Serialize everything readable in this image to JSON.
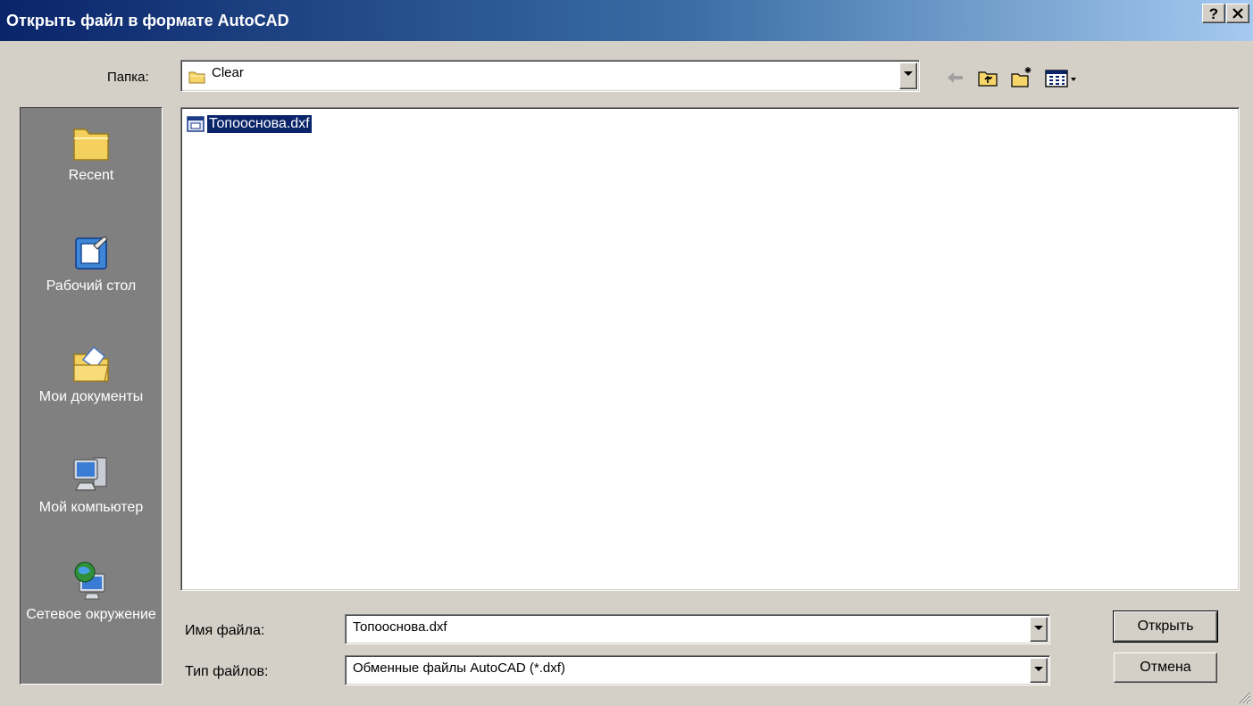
{
  "window": {
    "title": "Открыть файл в формате AutoCAD",
    "help_label": "?",
    "close_label": "✕"
  },
  "lookin": {
    "label": "Папка:",
    "value": "Clear"
  },
  "toolbar": {
    "icons": [
      "back-icon",
      "up-folder-icon",
      "new-folder-icon",
      "view-menu-icon"
    ]
  },
  "places": [
    {
      "label": "Recent",
      "icon": "recent-folder-icon"
    },
    {
      "label": "Рабочий стол",
      "icon": "desktop-icon"
    },
    {
      "label": "Мои документы",
      "icon": "my-documents-icon"
    },
    {
      "label": "Мой компьютер",
      "icon": "my-computer-icon"
    },
    {
      "label": "Сетевое окружение",
      "icon": "network-icon"
    }
  ],
  "files": [
    {
      "name": "Топооснова.dxf",
      "selected": true
    }
  ],
  "filename": {
    "label": "Имя файла:",
    "value": "Топооснова.dxf"
  },
  "filetype": {
    "label": "Тип файлов:",
    "value": "Обменные файлы AutoCAD (*.dxf)"
  },
  "buttons": {
    "open": "Открыть",
    "cancel": "Отмена"
  },
  "colors": {
    "titlebar_start": "#0a246a",
    "titlebar_end": "#a6caf0",
    "selection": "#0a246a",
    "face": "#d4d0c8"
  }
}
